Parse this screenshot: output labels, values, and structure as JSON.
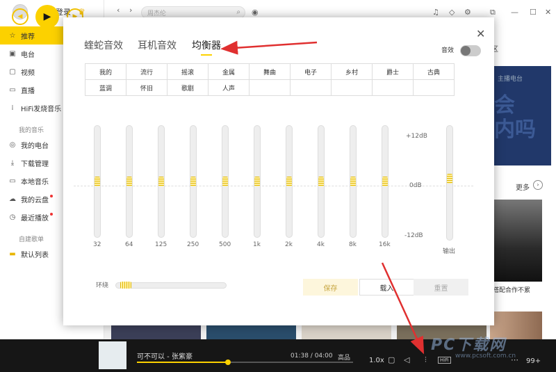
{
  "sidebar": {
    "login_label": "点此登录",
    "vip_icon": "crown-icon",
    "items": [
      {
        "label": "推荐",
        "icon": "star-icon",
        "active": true
      },
      {
        "label": "电台",
        "icon": "radio-icon"
      },
      {
        "label": "视频",
        "icon": "video-icon"
      },
      {
        "label": "直播",
        "icon": "live-icon"
      },
      {
        "label": "HiFi发烧音乐",
        "icon": "hifi-icon"
      }
    ],
    "section_my_music": "我的音乐",
    "my_items": [
      {
        "label": "我的电台",
        "icon": "my-radio-icon"
      },
      {
        "label": "下载管理",
        "icon": "download-icon"
      },
      {
        "label": "本地音乐",
        "icon": "local-music-icon"
      },
      {
        "label": "我的云盘",
        "icon": "cloud-icon",
        "dot": true
      },
      {
        "label": "最近播放",
        "icon": "history-icon",
        "dot": true
      }
    ],
    "section_playlists": "自建歌单",
    "playlists": [
      {
        "label": "默认列表",
        "icon": "folder-icon"
      }
    ]
  },
  "topbar": {
    "search_placeholder": "周杰伦"
  },
  "right_panel": {
    "tab_fragment": "区",
    "banner_tag": "主播电台",
    "banner_text_1": "会",
    "banner_text_2": "内吗",
    "more_label": "更多",
    "album_caption": "没搭配合作不累"
  },
  "dialog": {
    "tabs": [
      {
        "label": "蝰蛇音效"
      },
      {
        "label": "耳机音效"
      },
      {
        "label": "均衡器",
        "active": true
      }
    ],
    "effect_label": "音效",
    "effect_on": false,
    "presets": [
      [
        "我的",
        "流行",
        "摇滚",
        "金属",
        "舞曲",
        "电子",
        "乡村",
        "爵士",
        "古典"
      ],
      [
        "蓝调",
        "怀旧",
        "歌剧",
        "人声",
        "",
        "",
        "",
        "",
        ""
      ]
    ],
    "bands": [
      "32",
      "64",
      "125",
      "250",
      "500",
      "1k",
      "2k",
      "4k",
      "8k",
      "16k"
    ],
    "band_gains_db": [
      0,
      0,
      0,
      0,
      0,
      0,
      0,
      0,
      0,
      0
    ],
    "db_max": "+12dB",
    "db_mid": "0dB",
    "db_min": "-12dB",
    "output_label": "输出",
    "output_gain_db": 0,
    "surround_label": "环绕",
    "surround_level": 0.05,
    "save_label": "保存",
    "load_label": "载入",
    "reset_label": "重置"
  },
  "player": {
    "song": "可不可以 - 张紫豪",
    "time": "01:38 / 04:00",
    "progress": 0.41,
    "quality": "高品",
    "speed": "1.0x",
    "hifi_label": "HiFi",
    "playlist_count": "99+"
  },
  "watermark": {
    "text": "PC下载网",
    "url": "www.pcsoft.com.cn"
  },
  "colors": {
    "accent": "#fcd100",
    "player_bg": "#161616",
    "annotation_red": "#e03030"
  }
}
